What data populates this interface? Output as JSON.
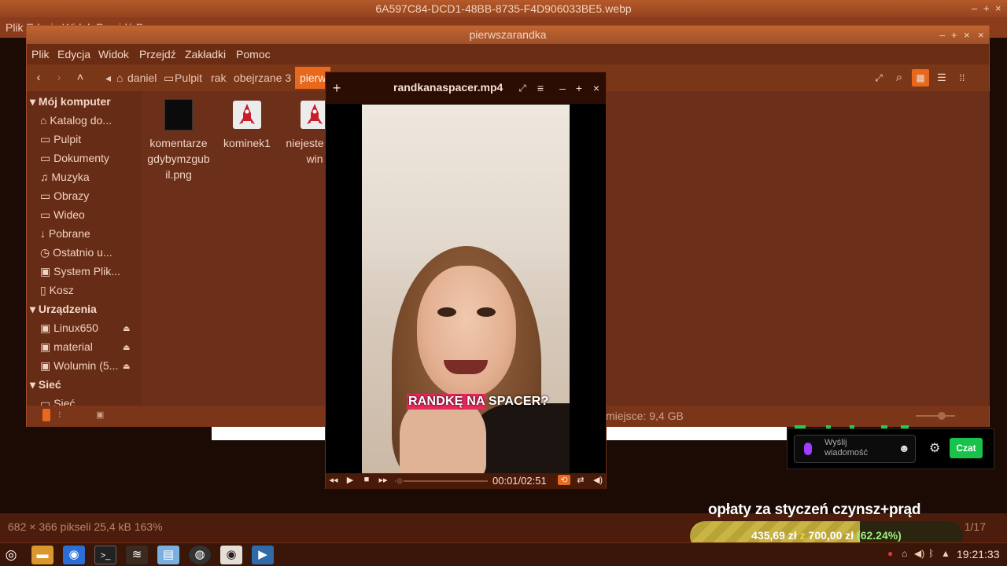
{
  "viewer": {
    "title": "6A597C84-DCD1-48BB-8735-F4D906033BE5.webp",
    "menu_partial": "Plik  Edycja  Widok  Przejdź  P",
    "status_left": "682 × 366 pikseli  25,4 kB   163%",
    "status_right": "1/17"
  },
  "file_manager": {
    "title": "pierwszarandka",
    "menu": [
      "Plik",
      "Edycja",
      "Widok",
      "Przejdź",
      "Zakładki",
      "Pomoc"
    ],
    "breadcrumbs": [
      "daniel",
      "Pulpit",
      "rak",
      "obejrzane 3"
    ],
    "breadcrumb_active": "pierw",
    "sidebar": {
      "sections": [
        {
          "title": "Mój komputer",
          "items": [
            "Katalog do...",
            "Pulpit",
            "Dokumenty",
            "Muzyka",
            "Obrazy",
            "Wideo",
            "Pobrane",
            "Ostatnio u...",
            "System Plik...",
            "Kosz"
          ]
        },
        {
          "title": "Urządzenia",
          "items": [
            "Linux650",
            "material",
            "Wolumin (5..."
          ]
        },
        {
          "title": "Sieć",
          "items": [
            "Sieć"
          ]
        }
      ]
    },
    "files": [
      {
        "name": "komentarzegdybymzgubil.png",
        "icon": "dark-image-thumbnail"
      },
      {
        "name": "kominek1",
        "icon": "rocket-icon"
      },
      {
        "name": "niejeste inicwin",
        "icon": "rocket-icon"
      }
    ],
    "status_free": "miejsce: 9,4 GB"
  },
  "player": {
    "title": "randkanaspacer.mp4",
    "caption": "RANDKĘ NA SPACER?",
    "time": "00:01/02:51",
    "progress": 0.006
  },
  "chat": {
    "placeholder": "Wyślij wiadomość",
    "send_label": "Czat"
  },
  "goal": {
    "title": "opłaty za styczeń czynsz+prąd",
    "current": "435,69 zł",
    "separator": "z",
    "target": "700,00 zł",
    "percent_label": "(62.24%)",
    "percent": 62.24
  },
  "taskbar": {
    "clock": "19:21:33",
    "apps": [
      "menu-icon",
      "files-icon",
      "firefox-icon",
      "terminal-icon",
      "steam-icon",
      "text-editor-icon",
      "obs-icon",
      "image-viewer-icon",
      "video-player-icon"
    ]
  }
}
